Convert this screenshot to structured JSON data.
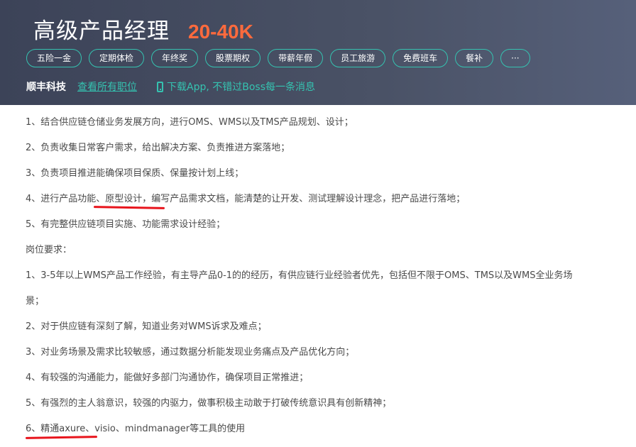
{
  "job": {
    "title": "高级产品经理",
    "salary": "20-40K"
  },
  "tags": [
    "五险一金",
    "定期体检",
    "年终奖",
    "股票期权",
    "带薪年假",
    "员工旅游",
    "免费班车",
    "餐补",
    "···"
  ],
  "company": {
    "name": "顺丰科技",
    "all_jobs_link": "查看所有职位",
    "app_download": "下载App, 不错过Boss每一条消息"
  },
  "description": {
    "lines": [
      "1、结合供应链仓储业务发展方向，进行OMS、WMS以及TMS产品规划、设计；",
      "2、负责收集日常客户需求，给出解决方案、负责推进方案落地；",
      "3、负责项目推进能确保项目保质、保量按计划上线；",
      "4、进行产品功能、原型设计，编写产品需求文档，能清楚的让开发、测试理解设计理念，把产品进行落地；",
      "5、有完整供应链项目实施、功能需求设计经验；",
      "岗位要求：",
      "1、3-5年以上WMS产品工作经验，有主导产品0-1的的经历，有供应链行业经验者优先，包括但不限于OMS、TMS以及WMS全业务场",
      "景；",
      "2、对于供应链有深刻了解，知道业务对WMS诉求及难点；",
      "3、对业务场景及需求比较敏感，通过数据分析能发现业务痛点及产品优化方向；",
      "4、有较强的沟通能力，能做好多部门沟通协作，确保项目正常推进；",
      "5、有强烈的主人翁意识，较强的内驱力，做事积极主动敢于打破传统意识具有创新精神；",
      "6、精通axure、visio、mindmanager等工具的使用"
    ]
  },
  "colors": {
    "header_bg": "#434a5e",
    "accent": "#35c2b0",
    "salary": "#ff6a3d",
    "annotation": "#e8141c"
  }
}
